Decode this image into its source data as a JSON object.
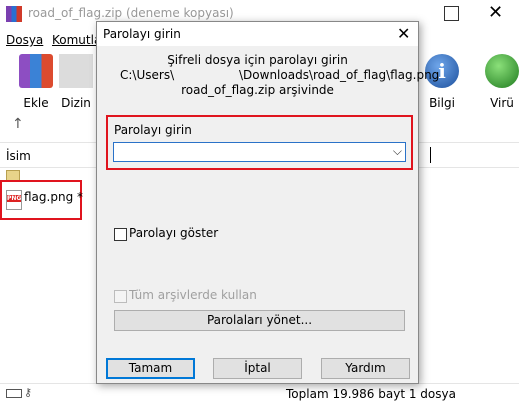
{
  "background": {
    "title": "road_of_flag.zip (deneme kopyası)",
    "menu": [
      "Dosya",
      "Komutlar"
    ],
    "toolbar": [
      {
        "label": "Ekle",
        "icon": "winrar-add-icon"
      },
      {
        "label": "Dizin",
        "icon": "folder-icon"
      },
      {
        "label": "Bilgi",
        "icon": "info-icon"
      },
      {
        "label": "Virü",
        "icon": "virus-scan-icon"
      }
    ],
    "column_header": "İsim",
    "file": {
      "icon_text": "PNG",
      "name": "flag.png *"
    },
    "status": "Toplam 19.986 bayt 1 dosya"
  },
  "dialog": {
    "title": "Parolayı girin",
    "close": "✕",
    "info_line1": "Şifreli dosya için parolayı girin",
    "path_left": "C:\\Users\\",
    "path_right": "\\Downloads\\road_of_flag\\flag.png",
    "info_line3": "road_of_flag.zip arşivinde",
    "password_label": "Parolayı girin",
    "password_value": "",
    "show_password_label": "Parolayı göster",
    "show_password_checked": false,
    "use_all_archives_label": "Tüm arşivlerde kullan",
    "use_all_archives_enabled": false,
    "manage_button": "Parolaları yönet...",
    "ok_button": "Tamam",
    "cancel_button": "İptal",
    "help_button": "Yardım"
  },
  "colors": {
    "highlight": "#e0141e",
    "focus": "#0078d7",
    "dialog_bg": "#f0f0f0"
  }
}
